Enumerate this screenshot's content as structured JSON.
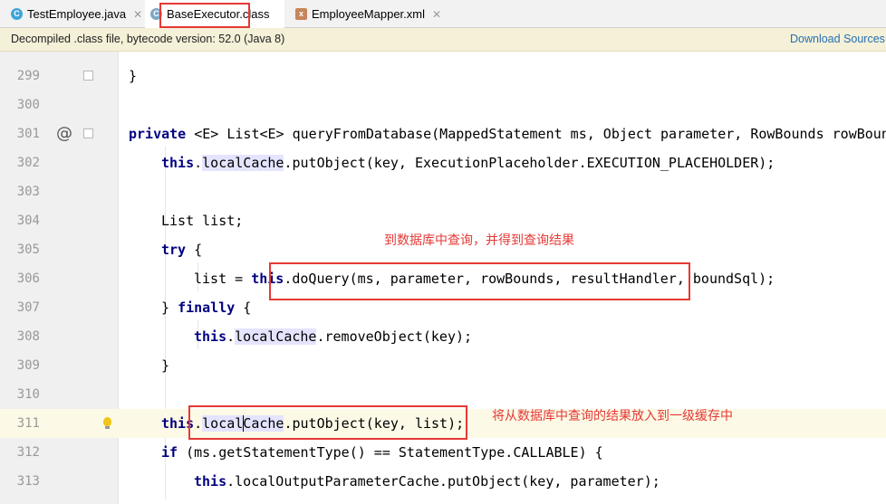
{
  "tabs": [
    {
      "label": "TestEmployee.java",
      "icon": "java-class-icon"
    },
    {
      "label": "BaseExecutor.class",
      "icon": "compiled-class-icon"
    },
    {
      "label": "EmployeeMapper.xml",
      "icon": "xml-file-icon"
    }
  ],
  "infobar": {
    "message": "Decompiled .class file, bytecode version: 52.0 (Java 8)",
    "link": "Download Sources"
  },
  "code": {
    "lines": [
      "299",
      "300",
      "301",
      "302",
      "303",
      "304",
      "305",
      "306",
      "307",
      "308",
      "309",
      "310",
      "311",
      "312",
      "313"
    ],
    "l299": "}",
    "l301": {
      "kw": "private",
      "rest": " <E> List<E> queryFromDatabase(MappedStatement ms, Object parameter, RowBounds rowBoun"
    },
    "l302": {
      "kw": "this",
      "dot": ".",
      "field": "localCache",
      "rest": ".putObject(key, ExecutionPlaceholder.EXECUTION_PLACEHOLDER);"
    },
    "l304": "List list;",
    "l305": {
      "kw": "try",
      "rest": " {"
    },
    "l306": {
      "pre": "list = ",
      "kw": "this",
      "rest": ".doQuery(ms, parameter, rowBounds, resultHandler, boundSql);"
    },
    "l307": {
      "pre": "} ",
      "kw": "finally",
      "rest": " {"
    },
    "l308": {
      "kw": "this",
      "dot": ".",
      "field": "localCache",
      "rest": ".removeObject(key);"
    },
    "l309": "}",
    "l311": {
      "kw": "this",
      "dot": ".",
      "field": "localCache",
      "rest": ".putObject(key, list);"
    },
    "l312": {
      "kw": "if",
      "rest": " (ms.getStatementType() == StatementType.CALLABLE) {"
    },
    "l313": {
      "kw": "this",
      "rest": ".localOutputParameterCache.putObject(key, parameter);"
    }
  },
  "annotations": {
    "note1": "到数据库中查询，并得到查询结果",
    "note2": "将从数据库中查询的结果放入到一级缓存中"
  },
  "colors": {
    "annotation": "#e53935",
    "keyword": "#000080",
    "field_highlight": "#e4e4ff",
    "current_line": "#fcfae6"
  }
}
